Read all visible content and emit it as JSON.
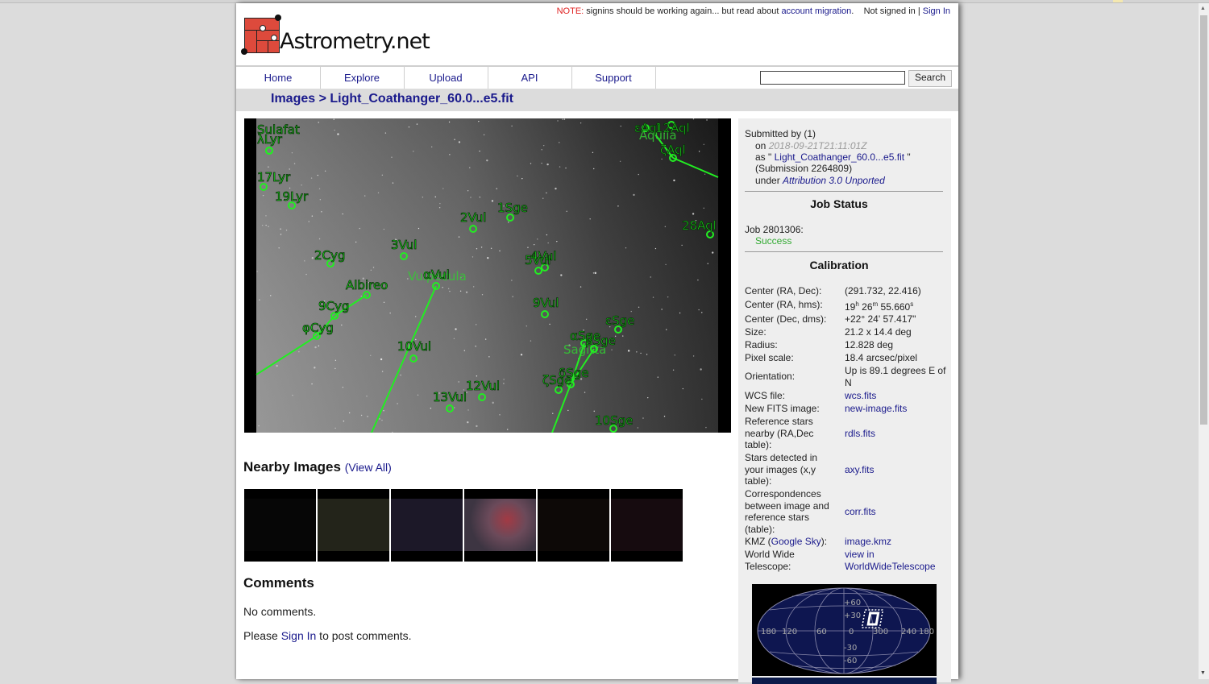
{
  "site": {
    "logo_text": "Astrometry.net",
    "notice_label": "NOTE:",
    "notice_text": " signins should be working again... but read about ",
    "notice_link": "account migration",
    "notice_end": ".",
    "signed_status": "Not signed in | ",
    "sign_in": "Sign In"
  },
  "nav": {
    "items": [
      "Home",
      "Explore",
      "Upload",
      "API",
      "Support"
    ],
    "search_value": "",
    "search_button": "Search"
  },
  "breadcrumb": {
    "root": "Images",
    "separator": " > ",
    "current": "Light_Coathanger_60.0...e5.fit"
  },
  "sky_annotations": {
    "stars": [
      {
        "label": "Sulafat"
      },
      {
        "label": "λLyr"
      },
      {
        "label": "17Lyr"
      },
      {
        "label": "19Lyr"
      },
      {
        "label": "2Vul"
      },
      {
        "label": "1Sge"
      },
      {
        "label": "3Vul"
      },
      {
        "label": "2Cyg"
      },
      {
        "label": "4Vul"
      },
      {
        "label": "5Vul"
      },
      {
        "label": "Albireo"
      },
      {
        "label": "αVul"
      },
      {
        "label": "9Cyg"
      },
      {
        "label": "φCyg"
      },
      {
        "label": "9Vul"
      },
      {
        "label": "εSge"
      },
      {
        "label": "αSge"
      },
      {
        "label": "βSge"
      },
      {
        "label": "10Vul"
      },
      {
        "label": "δSge"
      },
      {
        "label": "ζSge"
      },
      {
        "label": "12Vul"
      },
      {
        "label": "13Vul"
      },
      {
        "label": "10Sge"
      },
      {
        "label": "28Aql"
      },
      {
        "label": "ζAql"
      },
      {
        "label": "εAql"
      },
      {
        "label": "12Aql"
      }
    ],
    "constellations": [
      "Vulpecula",
      "Sagitta",
      "Aquila"
    ]
  },
  "nearby": {
    "title": "Nearby Images",
    "view_all": "View All",
    "thumbnails": [
      {
        "alt": "nearby-image-1",
        "tone": "#060606"
      },
      {
        "alt": "nearby-image-2",
        "tone": "#23241a"
      },
      {
        "alt": "nearby-image-3",
        "tone": "#1c1828"
      },
      {
        "alt": "nearby-image-4",
        "tone": "#4a3540"
      },
      {
        "alt": "nearby-image-5",
        "tone": "#0d0907"
      },
      {
        "alt": "nearby-image-6",
        "tone": "#160b0f"
      }
    ]
  },
  "comments": {
    "title": "Comments",
    "none": "No comments.",
    "please": "Please ",
    "sign_in": "Sign In",
    "to_post": " to post comments."
  },
  "submission": {
    "submitted_by": "Submitted by (1)",
    "on_label": "on ",
    "date": "2018-09-21T21:11:01Z",
    "as_label": "as \" ",
    "filename": "Light_Coathanger_60.0...e5.fit",
    "as_end": " \"",
    "submission_link": "(Submission 2264809)",
    "under_label": "under ",
    "license": "Attribution 3.0 Unported"
  },
  "job": {
    "heading": "Job Status",
    "job_label": "Job 2801306:",
    "status": "Success",
    "status_color": "#33aa33"
  },
  "calibration": {
    "heading": "Calibration",
    "rows": [
      {
        "key": "Center (RA, Dec):",
        "value": "(291.732, 22.416)"
      },
      {
        "key": "Center (RA, hms):",
        "value": "19h 26m 55.660s"
      },
      {
        "key": "Center (Dec, dms):",
        "value": "+22° 24' 57.417\""
      },
      {
        "key": "Size:",
        "value": "21.2 x 14.4 deg"
      },
      {
        "key": "Radius:",
        "value": "12.828 deg"
      },
      {
        "key": "Pixel scale:",
        "value": "18.4 arcsec/pixel"
      },
      {
        "key": "Orientation:",
        "value": "Up is 89.1 degrees E of N"
      },
      {
        "key": "WCS file:",
        "value": "wcs.fits"
      },
      {
        "key": "New FITS image:",
        "value": "new-image.fits"
      },
      {
        "key": "Reference stars nearby (RA,Dec table):",
        "value": "rdls.fits"
      },
      {
        "key": "Stars detected in your images (x,y table):",
        "value": "axy.fits"
      },
      {
        "key": "Correspondences between image and reference stars (table):",
        "value": "corr.fits"
      },
      {
        "key_prefix": "KMZ (",
        "key_link": "Google Sky",
        "key_suffix": "):",
        "value": "image.kmz"
      },
      {
        "key": "World Wide Telescope:",
        "value": "view in WorldWideTelescope"
      }
    ],
    "ra_h": "19",
    "ra_m": "26",
    "ra_s": "55.660"
  },
  "skymap": {
    "lat_labels": [
      "+60",
      "+30",
      "0",
      "-30",
      "-60"
    ],
    "lon_labels": [
      "180",
      "120",
      "60",
      "0",
      "300",
      "240",
      "180"
    ]
  }
}
